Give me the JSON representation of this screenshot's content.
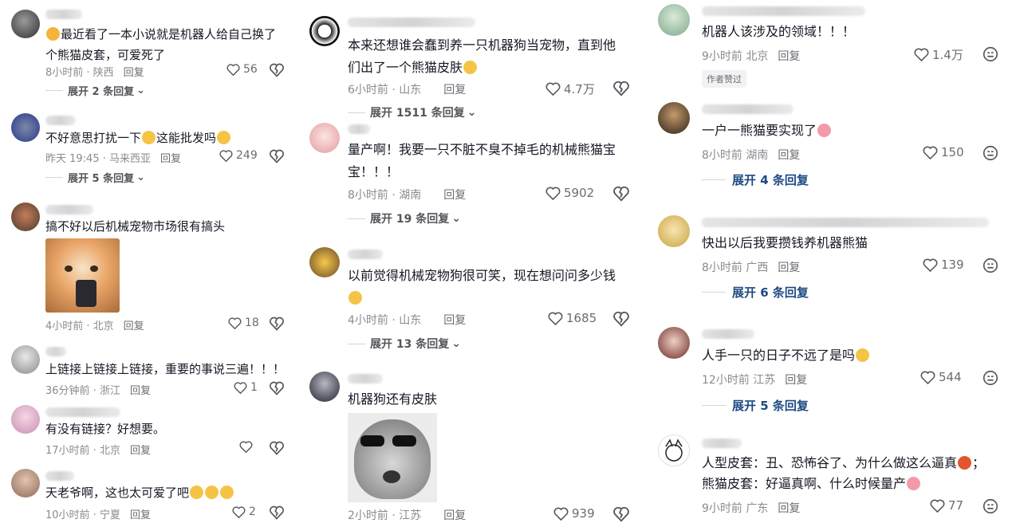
{
  "col1": [
    {
      "text": "最近看了一本小说就是机器人给自己换了个熊猫皮套，可爱死了",
      "meta": "8小时前 · 陕西",
      "reply": "回复",
      "likes": "56",
      "expand": "展开 2 条回复"
    },
    {
      "text_a": "不好意思打扰一下",
      "text_b": "这能批发吗",
      "meta": "昨天 19:45 · 马来西亚",
      "reply": "回复",
      "likes": "249",
      "expand": "展开 5 条回复"
    },
    {
      "text": "搞不好以后机械宠物市场很有搞头",
      "meta": "4小时前 · 北京",
      "reply": "回复",
      "likes": "18"
    },
    {
      "text": "上链接上链接上链接，重要的事说三遍！！！",
      "meta": "36分钟前 · 浙江",
      "reply": "回复",
      "likes": "1"
    },
    {
      "text": "有没有链接？好想要。",
      "meta": "17小时前 · 北京",
      "reply": "回复",
      "likes": ""
    },
    {
      "text": "天老爷啊，这也太可爱了吧",
      "meta": "10小时前 · 宁夏",
      "reply": "回复",
      "likes": "2"
    }
  ],
  "col2": [
    {
      "text": "本来还想谁会蠢到养一只机器狗当宠物，直到他们出了一个熊猫皮肤",
      "meta": "6小时前 · 山东",
      "reply": "回复",
      "likes": "4.7万",
      "expand": "展开 1511 条回复"
    },
    {
      "text": "量产啊！我要一只不脏不臭不掉毛的机械熊猫宝宝！！！",
      "meta": "8小时前 · 湖南",
      "reply": "回复",
      "likes": "5902",
      "expand": "展开 19 条回复"
    },
    {
      "text": "以前觉得机械宠物狗很可笑，现在想问问多少钱",
      "meta": "4小时前 · 山东",
      "reply": "回复",
      "likes": "1685",
      "expand": "展开 13 条回复"
    },
    {
      "text": "机器狗还有皮肤",
      "meta": "2小时前 · 江苏",
      "reply": "回复",
      "likes": "939"
    }
  ],
  "col3": [
    {
      "text": "机器人该涉及的领域！！！",
      "meta": "9小时前 北京",
      "reply": "回复",
      "likes": "1.4万",
      "tag": "作者赞过"
    },
    {
      "text": "一户一熊猫要实现了",
      "meta": "8小时前 湖南",
      "reply": "回复",
      "likes": "150",
      "expand": "展开 4 条回复"
    },
    {
      "text": "快出以后我要攒钱养机器熊猫",
      "meta": "8小时前 广西",
      "reply": "回复",
      "likes": "139",
      "expand": "展开 6 条回复"
    },
    {
      "text": "人手一只的日子不远了是吗",
      "meta": "12小时前 江苏",
      "reply": "回复",
      "likes": "544",
      "expand": "展开 5 条回复"
    },
    {
      "text_a": "人型皮套：丑、恐怖谷了、为什么做这么逼真",
      "text_b": "；",
      "text_c": "熊猫皮套：好逼真啊、什么时候量产",
      "meta": "9小时前 广东",
      "reply": "回复",
      "likes": "77"
    }
  ],
  "icons": {
    "like": "heart-icon",
    "dislike": "broken-heart-icon",
    "share": "emoji-face-icon",
    "chevron": "chevron-down-icon"
  }
}
